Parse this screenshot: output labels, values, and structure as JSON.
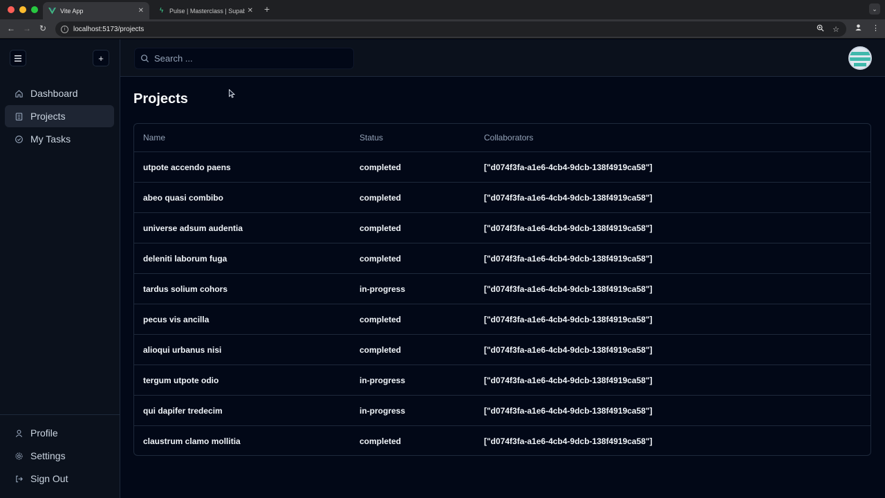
{
  "browser": {
    "tabs": [
      {
        "title": "Vite App",
        "active": true
      },
      {
        "title": "Pulse | Masterclass | Supabase",
        "active": false
      }
    ],
    "url": "localhost:5173/projects"
  },
  "sidebar": {
    "nav": [
      {
        "label": "Dashboard",
        "icon": "home-icon"
      },
      {
        "label": "Projects",
        "icon": "building-icon",
        "active": true
      },
      {
        "label": "My Tasks",
        "icon": "check-circle-icon"
      }
    ],
    "bottom": [
      {
        "label": "Profile",
        "icon": "user-icon"
      },
      {
        "label": "Settings",
        "icon": "gear-icon"
      },
      {
        "label": "Sign Out",
        "icon": "logout-icon"
      }
    ]
  },
  "topbar": {
    "search_placeholder": "Search ..."
  },
  "page": {
    "title": "Projects"
  },
  "table": {
    "headers": [
      "Name",
      "Status",
      "Collaborators"
    ],
    "rows": [
      {
        "name": "utpote accendo paens",
        "status": "completed",
        "collaborators": "[\"d074f3fa-a1e6-4cb4-9dcb-138f4919ca58\"]"
      },
      {
        "name": "abeo quasi combibo",
        "status": "completed",
        "collaborators": "[\"d074f3fa-a1e6-4cb4-9dcb-138f4919ca58\"]"
      },
      {
        "name": "universe adsum audentia",
        "status": "completed",
        "collaborators": "[\"d074f3fa-a1e6-4cb4-9dcb-138f4919ca58\"]"
      },
      {
        "name": "deleniti laborum fuga",
        "status": "completed",
        "collaborators": "[\"d074f3fa-a1e6-4cb4-9dcb-138f4919ca58\"]"
      },
      {
        "name": "tardus solium cohors",
        "status": "in-progress",
        "collaborators": "[\"d074f3fa-a1e6-4cb4-9dcb-138f4919ca58\"]"
      },
      {
        "name": "pecus vis ancilla",
        "status": "completed",
        "collaborators": "[\"d074f3fa-a1e6-4cb4-9dcb-138f4919ca58\"]"
      },
      {
        "name": "alioqui urbanus nisi",
        "status": "completed",
        "collaborators": "[\"d074f3fa-a1e6-4cb4-9dcb-138f4919ca58\"]"
      },
      {
        "name": "tergum utpote odio",
        "status": "in-progress",
        "collaborators": "[\"d074f3fa-a1e6-4cb4-9dcb-138f4919ca58\"]"
      },
      {
        "name": "qui dapifer tredecim",
        "status": "in-progress",
        "collaborators": "[\"d074f3fa-a1e6-4cb4-9dcb-138f4919ca58\"]"
      },
      {
        "name": "claustrum clamo mollitia",
        "status": "completed",
        "collaborators": "[\"d074f3fa-a1e6-4cb4-9dcb-138f4919ca58\"]"
      }
    ]
  },
  "colors": {
    "background": "#020817",
    "sidebar": "#0b111c",
    "border": "#1e293b",
    "avatar_accent": "#3fb8ab"
  }
}
